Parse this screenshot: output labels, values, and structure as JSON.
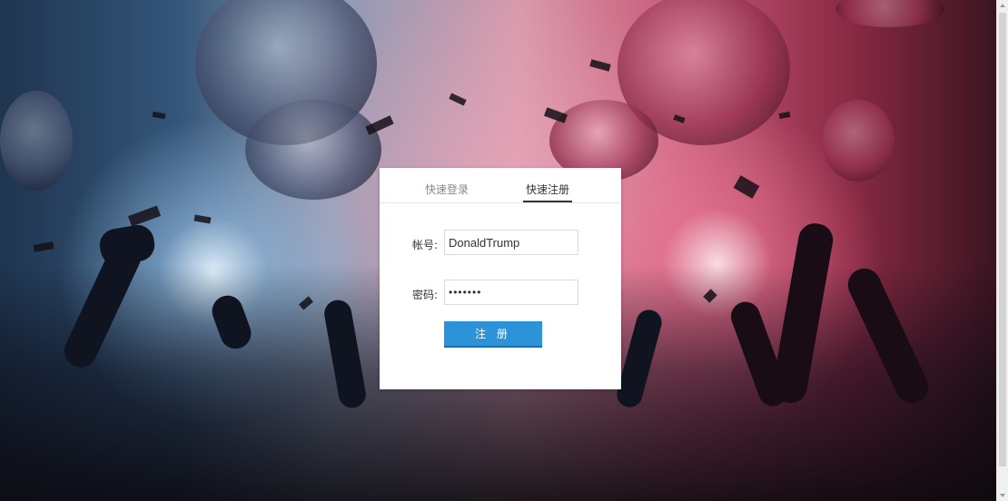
{
  "tabs": {
    "login_label": "快速登录",
    "register_label": "快速注册",
    "active": "register"
  },
  "form": {
    "account_label": "帐号:",
    "account_value": "DonaldTrump",
    "password_label": "密码:",
    "password_value": "•••••••",
    "submit_label": "注 册"
  },
  "colors": {
    "submit_bg": "#2d93d9",
    "card_bg": "#ffffff"
  },
  "icons": {
    "scroll_up": "scroll-up-arrow",
    "scroll_down": "scroll-down-arrow"
  }
}
